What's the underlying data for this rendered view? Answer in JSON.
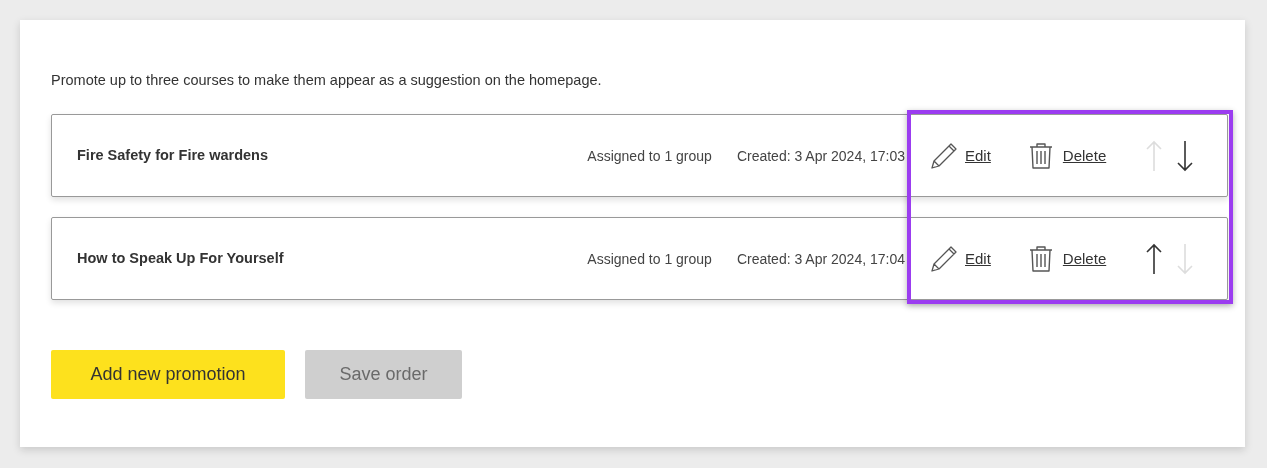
{
  "intro": "Promote up to three courses to make them appear as a suggestion on the homepage.",
  "promotions": [
    {
      "title": "Fire Safety for Fire wardens",
      "assigned": "Assigned to 1 group",
      "created": "Created: 3 Apr 2024, 17:03",
      "edit": "Edit",
      "delete": "Delete",
      "up_disabled": true,
      "down_disabled": false
    },
    {
      "title": "How to Speak Up For Yourself",
      "assigned": "Assigned to 1 group",
      "created": "Created: 3 Apr 2024, 17:04",
      "edit": "Edit",
      "delete": "Delete",
      "up_disabled": false,
      "down_disabled": true
    }
  ],
  "highlight_actions": true,
  "buttons": [
    {
      "label": "Add new promotion",
      "disabled": false
    },
    {
      "label": "Save order",
      "disabled": true
    }
  ]
}
